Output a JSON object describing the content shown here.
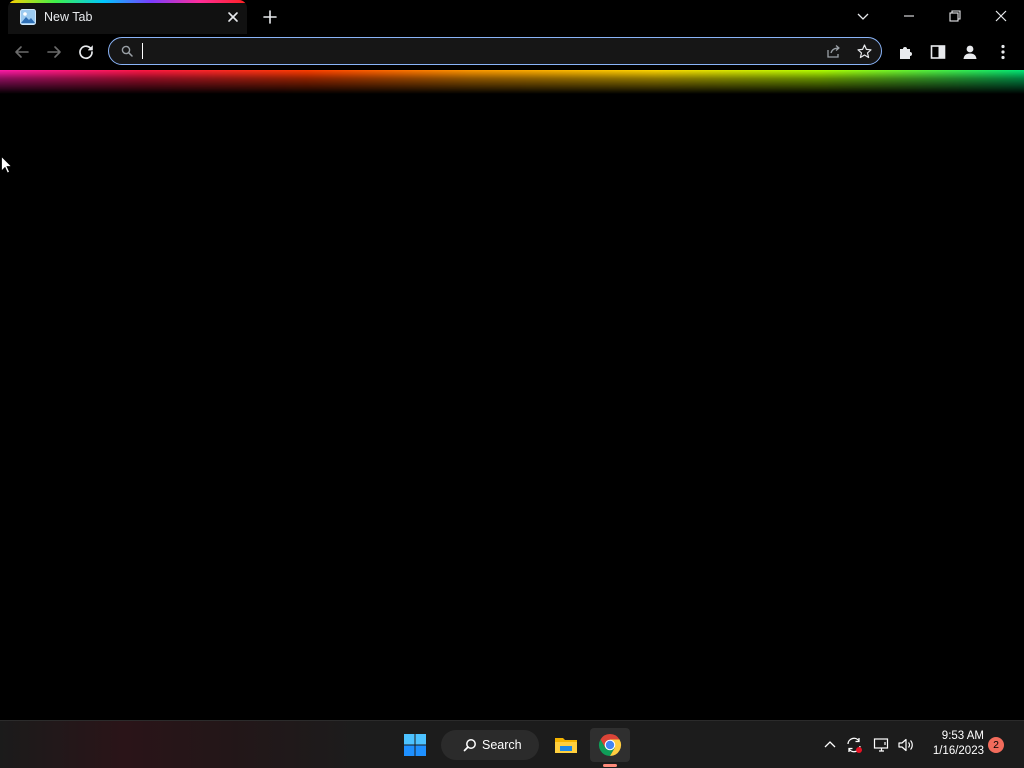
{
  "browser": {
    "tabs": [
      {
        "title": "New Tab",
        "favicon": "image-icon"
      }
    ],
    "new_tab_icon": "plus-icon",
    "window_controls": [
      "chevron-down-icon",
      "minimize-icon",
      "restore-icon",
      "close-icon"
    ],
    "toolbar": {
      "nav_icons": [
        "back-arrow-icon",
        "forward-arrow-icon",
        "reload-icon"
      ],
      "right_icons": [
        "extensions-icon",
        "side-panel-icon",
        "profile-icon",
        "more-menu-icon"
      ]
    },
    "omnibox": {
      "value": "",
      "placeholder": "",
      "leading_icon": "search-icon",
      "trailing_icons": [
        "share-icon",
        "bookmark-star-icon"
      ]
    }
  },
  "page": {
    "background": "#000000",
    "glow_colors": [
      "#ff1aa8",
      "#ff1744",
      "#ff3d00",
      "#ff9800",
      "#ffd600",
      "#b2ff00",
      "#00e676"
    ]
  },
  "taskbar": {
    "search_label": "Search",
    "apps": [
      {
        "name": "file-explorer-icon",
        "active": false
      },
      {
        "name": "chrome-icon",
        "active": true
      }
    ],
    "tray_icons": [
      "show-hidden-icons-chevron",
      "sync-icon",
      "network-icon",
      "volume-icon"
    ],
    "clock": {
      "time": "9:53 AM",
      "date": "1/16/2023"
    },
    "notification_count": "2"
  },
  "colors": {
    "accent_focus": "#8ab4f8",
    "taskbar_bg": "#1c1c1c",
    "notification_badge": "#f26b5b"
  }
}
